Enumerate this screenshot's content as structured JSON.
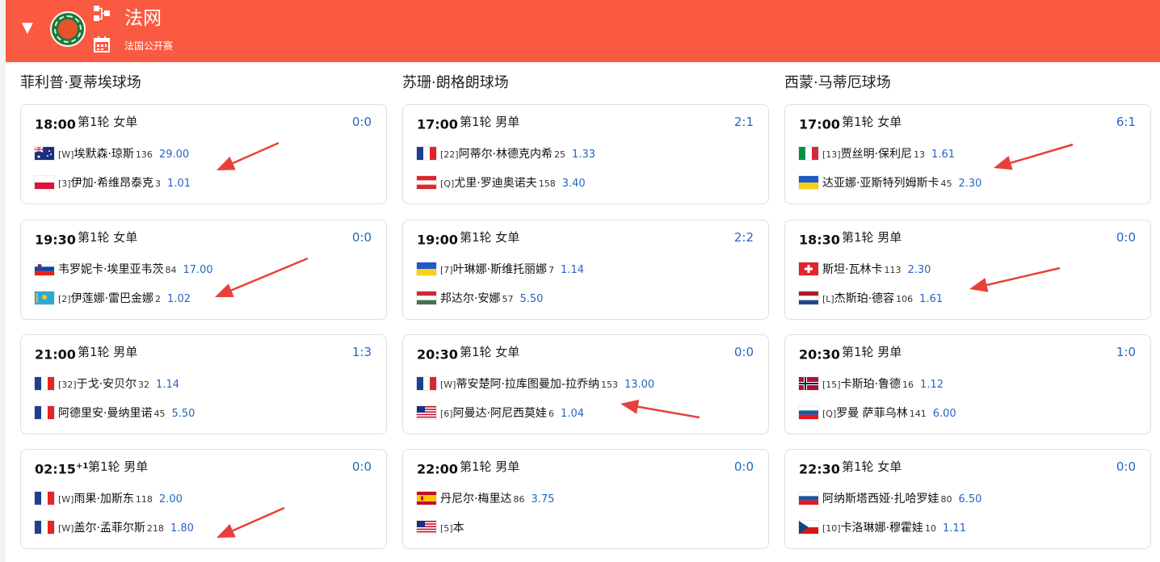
{
  "header": {
    "title": "法网",
    "subtitle": "法国公开赛",
    "accent": "#fa5a41"
  },
  "columns": [
    {
      "court": "菲利普·夏蒂埃球场",
      "matches": [
        {
          "time": "18:00",
          "time_sup": "",
          "round": "第1轮 女单",
          "score": "0:0",
          "p1": {
            "flag": "australia-flag",
            "seed": "[W]",
            "name": "埃默森·琼斯",
            "rank": "136",
            "odds": "29.00"
          },
          "p2": {
            "flag": "poland-flag",
            "seed": "[3]",
            "name": "伊加·希维昂泰克",
            "rank": "3",
            "odds": "1.01"
          }
        },
        {
          "time": "19:30",
          "time_sup": "",
          "round": "第1轮 女单",
          "score": "0:0",
          "p1": {
            "flag": "slovenia-flag",
            "seed": "",
            "name": "韦罗妮卡·埃里亚韦茨",
            "rank": "84",
            "odds": "17.00"
          },
          "p2": {
            "flag": "kazakhstan-flag",
            "seed": "[2]",
            "name": "伊莲娜·雷巴金娜",
            "rank": "2",
            "odds": "1.02"
          }
        },
        {
          "time": "21:00",
          "time_sup": "",
          "round": "第1轮 男单",
          "score": "1:3",
          "p1": {
            "flag": "france-flag",
            "seed": "[32]",
            "name": "于戈·安贝尔",
            "rank": "32",
            "odds": "1.14"
          },
          "p2": {
            "flag": "france-flag",
            "seed": "",
            "name": "阿德里安·曼纳里诺",
            "rank": "45",
            "odds": "5.50"
          }
        },
        {
          "time": "02:15",
          "time_sup": "+1",
          "round": "第1轮 男单",
          "score": "0:0",
          "p1": {
            "flag": "france-flag",
            "seed": "[W]",
            "name": "雨果·加斯东",
            "rank": "118",
            "odds": "2.00"
          },
          "p2": {
            "flag": "france-flag",
            "seed": "[W]",
            "name": "盖尔·孟菲尔斯",
            "rank": "218",
            "odds": "1.80"
          }
        }
      ]
    },
    {
      "court": "苏珊·朗格朗球场",
      "matches": [
        {
          "time": "17:00",
          "time_sup": "",
          "round": "第1轮 男单",
          "score": "2:1",
          "p1": {
            "flag": "france-flag",
            "seed": "[22]",
            "name": "阿蒂尔·林德克内希",
            "rank": "25",
            "odds": "1.33"
          },
          "p2": {
            "flag": "austria-flag",
            "seed": "[Q]",
            "name": "尤里·罗迪奥诺夫",
            "rank": "158",
            "odds": "3.40"
          }
        },
        {
          "time": "19:00",
          "time_sup": "",
          "round": "第1轮 女单",
          "score": "2:2",
          "p1": {
            "flag": "ukraine-flag",
            "seed": "[7]",
            "name": "叶琳娜·斯维托丽娜",
            "rank": "7",
            "odds": "1.14"
          },
          "p2": {
            "flag": "hungary-flag",
            "seed": "",
            "name": "邦达尔·安娜",
            "rank": "57",
            "odds": "5.50"
          }
        },
        {
          "time": "20:30",
          "time_sup": "",
          "round": "第1轮 女单",
          "score": "0:0",
          "p1": {
            "flag": "france-flag",
            "seed": "[W]",
            "name": "蒂安楚阿·拉库图曼加-拉乔纳",
            "rank": "153",
            "odds": "13.00"
          },
          "p2": {
            "flag": "usa-flag",
            "seed": "[6]",
            "name": "阿曼达·阿尼西莫娃",
            "rank": "6",
            "odds": "1.04"
          }
        },
        {
          "time": "22:00",
          "time_sup": "",
          "round": "第1轮 男单",
          "score": "0:0",
          "p1": {
            "flag": "spain-flag",
            "seed": "",
            "name": "丹尼尔·梅里达",
            "rank": "86",
            "odds": "3.75"
          },
          "p2": {
            "flag": "usa-flag",
            "seed": "[5]",
            "name": "本",
            "rank": "",
            "odds": ""
          }
        }
      ]
    },
    {
      "court": "西蒙·马蒂厄球场",
      "matches": [
        {
          "time": "17:00",
          "time_sup": "",
          "round": "第1轮 女单",
          "score": "6:1",
          "p1": {
            "flag": "italy-flag",
            "seed": "[13]",
            "name": "贾丝明·保利尼",
            "rank": "13",
            "odds": "1.61"
          },
          "p2": {
            "flag": "ukraine-flag",
            "seed": "",
            "name": "达亚娜·亚斯特列姆斯卡",
            "rank": "45",
            "odds": "2.30"
          }
        },
        {
          "time": "18:30",
          "time_sup": "",
          "round": "第1轮 男单",
          "score": "0:0",
          "p1": {
            "flag": "switzerland-flag",
            "seed": "",
            "name": "斯坦·瓦林卡",
            "rank": "113",
            "odds": "2.30"
          },
          "p2": {
            "flag": "netherlands-flag",
            "seed": "[L]",
            "name": "杰斯珀·德容",
            "rank": "106",
            "odds": "1.61"
          }
        },
        {
          "time": "20:30",
          "time_sup": "",
          "round": "第1轮 男单",
          "score": "1:0",
          "p1": {
            "flag": "norway-flag",
            "seed": "[15]",
            "name": "卡斯珀·鲁德",
            "rank": "16",
            "odds": "1.12"
          },
          "p2": {
            "flag": "russia-flag",
            "seed": "[Q]",
            "name": "罗曼 萨菲乌林",
            "rank": "141",
            "odds": "6.00"
          }
        },
        {
          "time": "22:30",
          "time_sup": "",
          "round": "第1轮 女单",
          "score": "0:0",
          "p1": {
            "flag": "russia-flag",
            "seed": "",
            "name": "阿纳斯塔西娅·扎哈罗娃",
            "rank": "80",
            "odds": "6.50"
          },
          "p2": {
            "flag": "czech-flag",
            "seed": "[10]",
            "name": "卡洛琳娜·穆霍娃",
            "rank": "10",
            "odds": "1.11"
          }
        }
      ]
    }
  ]
}
